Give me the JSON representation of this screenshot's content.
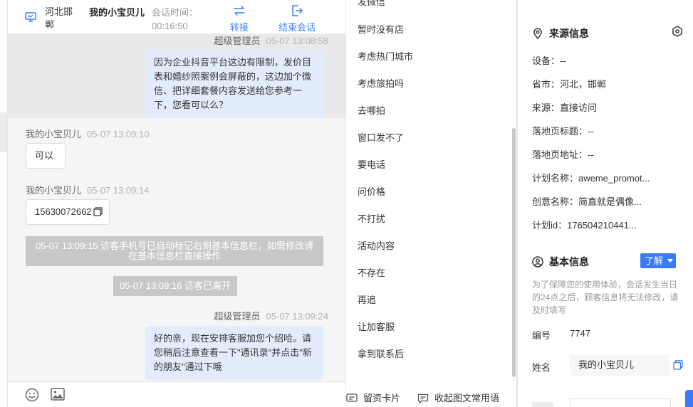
{
  "header": {
    "location": "河北邯郸",
    "visitor_name": "我的小宝贝儿",
    "session_time_label": "会话时间：",
    "session_time": "00:16:50",
    "transfer_label": "转接",
    "end_label": "结束会话"
  },
  "messages": {
    "m1": {
      "sender": "超级管理员",
      "time": "05-07 13:08:58",
      "text": "因为企业抖音平台这边有限制，发价目表和婚纱照案例会屏蔽的，这边加个微信、把详细套餐内容发送给您参考一下，您看可以么？"
    },
    "m2": {
      "sender": "我的小宝贝儿",
      "time": "05-07 13:09:10",
      "text": "可以"
    },
    "m3": {
      "sender": "我的小宝贝儿",
      "time": "05-07 13:09:14",
      "text": "15630072662"
    },
    "sys1": "05-07 13:09:15 访客手机号已自动标记右侧基本信息栏，如需修改请在基本信息栏直接操作",
    "sys2": "05-07 13:09:16 访客已离开",
    "m4": {
      "sender": "超级管理员",
      "time": "05-07 13:09:24",
      "text": "好的亲，现在安排客服加您个绍哈。请您稍后注意查看一下\"通讯录\"并点击\"新的朋友\"通过下哦"
    }
  },
  "quick_replies": {
    "partial": "发微信",
    "items": [
      "暂时没有店",
      "考虑热门城市",
      "考虑旅拍吗",
      "去哪拍",
      "窗口发不了",
      "要电话",
      "问价格",
      "不打扰",
      "活动内容",
      "不存在",
      "再追",
      "让加客服",
      "拿到联系后"
    ],
    "footer_card": "留资卡片",
    "footer_collapse": "收起图文常用语"
  },
  "source_info": {
    "title": "来源信息",
    "rows": [
      "设备：--",
      "省市：河北，邯郸",
      "来源：直接访问",
      "落地页标题：--",
      "落地页地址：--",
      "计划名称：aweme_promot...",
      "创意名称：简直就是偶像...",
      "计划id：176504210441..."
    ]
  },
  "basic_info": {
    "title": "基本信息",
    "learn_label": "了解",
    "note": "为了保障您的使用体验，会话发生当日的24点之后，顾客信息将无法修改，请及时填写",
    "id_label": "编号",
    "id_value": "7747",
    "name_label": "姓名",
    "name_value": "我的小宝贝儿"
  },
  "colors": {
    "accent": "#3a7bf7",
    "agent_bubble": "#e3ecfd",
    "system_note": "#c8c8c8"
  },
  "icons": {
    "monitor": "monitor-icon",
    "transfer": "transfer-icon",
    "end": "exit-icon",
    "emoji": "emoji-icon",
    "image": "image-icon",
    "location": "location-pin-icon",
    "settings": "settings-icon",
    "user": "user-icon",
    "copy": "copy-icon",
    "card": "card-icon",
    "collapse": "chat-icon"
  }
}
